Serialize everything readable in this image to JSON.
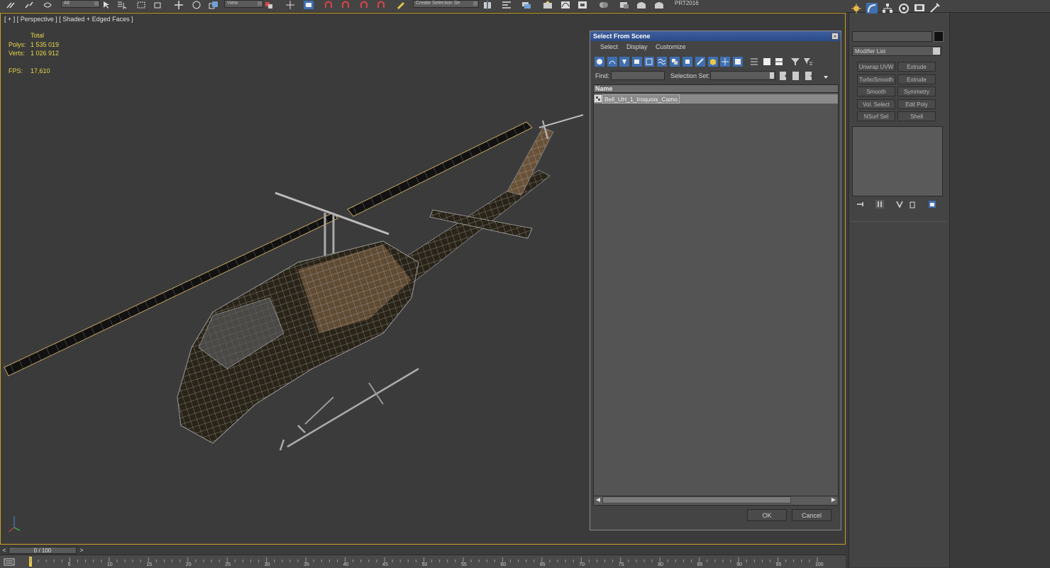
{
  "toolbar": {
    "selection_filter": "All",
    "ref_coord": "View",
    "named_selection": "Create Selection Se",
    "app_label": "PRT2016",
    "icons": [
      "link-icon",
      "unlink-icon",
      "bind-spacewarp-icon",
      "select-object-icon",
      "select-by-name-icon",
      "rect-select-icon",
      "window-crossing-icon",
      "move-icon",
      "rotate-icon",
      "scale-icon",
      "pivot-icon",
      "snap-toggle-icon",
      "angle-snap-icon",
      "percent-snap-icon",
      "spinner-snap-icon",
      "edit-named-sel-icon",
      "mirror-icon",
      "align-icon",
      "layer-icon",
      "graphite-icon",
      "curve-editor-icon",
      "schematic-icon",
      "material-editor-icon",
      "render-setup-icon",
      "render-frame-icon",
      "render-icon"
    ]
  },
  "viewport": {
    "label": "[ + ] [ Perspective ] [ Shaded + Edged Faces ]",
    "stats": {
      "total_label": "Total",
      "polys_label": "Polys:",
      "polys_value": "1 535 019",
      "verts_label": "Verts:",
      "verts_value": "1 026 912",
      "fps_label": "FPS:",
      "fps_value": "17,610"
    }
  },
  "dialog": {
    "title": "Select From Scene",
    "close": "×",
    "menu": [
      "Select",
      "Display",
      "Customize"
    ],
    "find_label": "Find:",
    "find_value": "",
    "selection_set_label": "Selection Set:",
    "selection_set_value": "",
    "column_name": "Name",
    "rows": [
      {
        "name": "Bell_UH_1_Iroquois_Camo",
        "selected": true
      }
    ],
    "ok": "OK",
    "cancel": "Cancel"
  },
  "command_panel": {
    "tabs": [
      "create-tab",
      "modify-tab",
      "hierarchy-tab",
      "motion-tab",
      "display-tab",
      "utilities-tab"
    ],
    "object_name": "",
    "object_color": "#111111",
    "modifier_list": "Modifier List",
    "modifier_buttons": [
      "Unwrap UVW",
      "Extrude",
      "TurboSmooth",
      "Extrude",
      "Smooth",
      "Symmetry",
      "Vol. Select",
      "Edit Poly",
      "NSurf Sel",
      "Shell"
    ]
  },
  "timeline": {
    "frame": "0 / 100",
    "prev": "<",
    "next": ">",
    "ticks": [
      "5",
      "10",
      "15",
      "20",
      "25",
      "30",
      "35",
      "40",
      "45",
      "50",
      "55",
      "60",
      "65",
      "70",
      "75",
      "80",
      "85",
      "90",
      "95",
      "100"
    ]
  },
  "colors": {
    "viewport_border": "#c9a227",
    "stats_text": "#e8d84a",
    "title_bar": "#2a4b8a",
    "selected_row": "#8a8a8a"
  }
}
